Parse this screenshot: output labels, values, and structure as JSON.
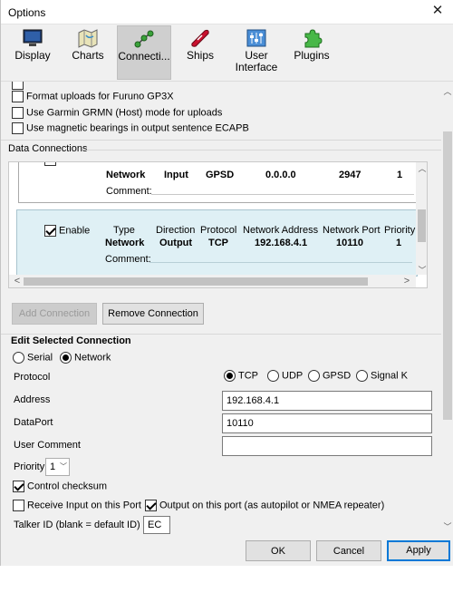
{
  "window": {
    "title": "Options",
    "close_glyph": "✕"
  },
  "toolbar": {
    "items": [
      {
        "label": "Display",
        "icon": "monitor-icon",
        "selected": false
      },
      {
        "label": "Charts",
        "icon": "chart-map-icon",
        "selected": false
      },
      {
        "label": "Connecti...",
        "icon": "connections-icon",
        "selected": true
      },
      {
        "label": "Ships",
        "icon": "ship-icon",
        "selected": false
      },
      {
        "label": "User\nInterface",
        "icon": "sliders-icon",
        "selected": false
      },
      {
        "label": "Plugins",
        "icon": "puzzle-icon",
        "selected": false
      }
    ]
  },
  "top_options": {
    "partial_label": "",
    "furuno": "Format uploads for Furuno GP3X",
    "garmin": "Use Garmin GRMN (Host) mode for uploads",
    "magnetic": "Use magnetic bearings in output sentence ECAPB"
  },
  "data_connections": {
    "title": "Data Connections",
    "card1": {
      "network": "Network",
      "direction": "Input",
      "protocol": "GPSD",
      "address": "0.0.0.0",
      "port": "2947",
      "priority": "1",
      "comment_label": "Comment:"
    },
    "card2": {
      "enable_label": "Enable",
      "enabled": true,
      "headers": {
        "type": "Type",
        "direction": "Direction",
        "protocol": "Protocol",
        "address": "Network Address",
        "port": "Network Port",
        "priority": "Priority"
      },
      "type": "Network",
      "direction": "Output",
      "protocol": "TCP",
      "address": "192.168.4.1",
      "port": "10110",
      "priority": "1",
      "comment_label": "Comment:"
    },
    "add_button": "Add Connection",
    "remove_button": "Remove Connection"
  },
  "edit": {
    "title": "Edit Selected Connection",
    "serial": "Serial",
    "network": "Network",
    "protocol_label": "Protocol",
    "protocols": [
      "TCP",
      "UDP",
      "GPSD",
      "Signal K"
    ],
    "selected_protocol": "TCP",
    "address_label": "Address",
    "address_value": "192.168.4.1",
    "dataport_label": "DataPort",
    "dataport_value": "10110",
    "comment_label": "User Comment",
    "comment_value": "",
    "priority_label": "Priority",
    "priority_value": "1",
    "control_checksum": "Control checksum",
    "receive_input": "Receive Input on this Port",
    "output_port": "Output on this port (as autopilot or NMEA repeater)",
    "talker_label": "Talker ID (blank = default ID)",
    "talker_value": "EC"
  },
  "footer": {
    "ok": "OK",
    "cancel": "Cancel",
    "apply": "Apply"
  },
  "colors": {
    "card_selected_bg": "#dff0f5",
    "accent_border": "#0078d7"
  }
}
